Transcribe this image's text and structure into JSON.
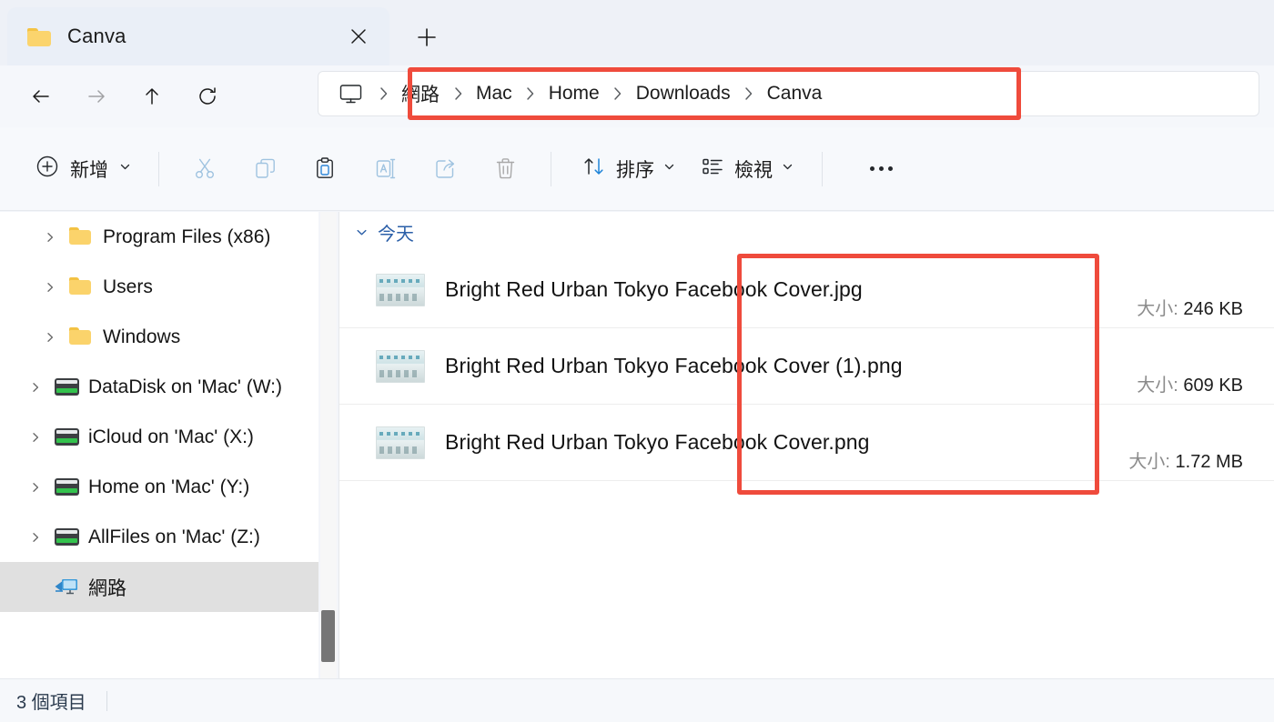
{
  "window": {
    "tab": {
      "title": "Canva",
      "icon": "folder-icon",
      "close_icon": "close-icon"
    },
    "new_tab_icon": "plus-icon"
  },
  "nav": {
    "back_icon": "arrow-left-icon",
    "forward_icon": "arrow-right-icon",
    "up_icon": "arrow-up-icon",
    "refresh_icon": "refresh-icon"
  },
  "address": {
    "root_icon": "monitor-icon",
    "separator": "chevron-right-icon",
    "crumbs": [
      {
        "label": "網路"
      },
      {
        "label": "Mac"
      },
      {
        "label": "Home"
      },
      {
        "label": "Downloads"
      },
      {
        "label": "Canva"
      }
    ]
  },
  "toolbar": {
    "new_label": "新增",
    "new_icon": "plus-circle-icon",
    "new_chevron": "chevron-down-icon",
    "actions": [
      {
        "name": "cut-button",
        "icon": "scissors-icon",
        "disabled": true
      },
      {
        "name": "copy-button",
        "icon": "copy-icon",
        "disabled": true
      },
      {
        "name": "paste-button",
        "icon": "paste-icon",
        "disabled": false
      },
      {
        "name": "rename-button",
        "icon": "rename-icon",
        "disabled": true
      },
      {
        "name": "share-button",
        "icon": "share-icon",
        "disabled": true
      },
      {
        "name": "delete-button",
        "icon": "trash-icon",
        "disabled": true
      }
    ],
    "sort_label": "排序",
    "sort_icon": "sort-icon",
    "view_label": "檢視",
    "view_icon": "view-list-icon",
    "overflow_icon": "more-horizontal-icon"
  },
  "sidebar": {
    "items": [
      {
        "label": "Program Files (x86)",
        "icon": "folder-icon",
        "indent": 2,
        "expandable": true,
        "selected": false
      },
      {
        "label": "Users",
        "icon": "folder-icon",
        "indent": 2,
        "expandable": true,
        "selected": false
      },
      {
        "label": "Windows",
        "icon": "folder-icon",
        "indent": 2,
        "expandable": true,
        "selected": false
      },
      {
        "label": "DataDisk on 'Mac' (W:)",
        "icon": "drive-icon",
        "indent": 1,
        "expandable": true,
        "selected": false
      },
      {
        "label": "iCloud on 'Mac' (X:)",
        "icon": "drive-icon",
        "indent": 1,
        "expandable": true,
        "selected": false
      },
      {
        "label": "Home on 'Mac' (Y:)",
        "icon": "drive-icon",
        "indent": 1,
        "expandable": true,
        "selected": false
      },
      {
        "label": "AllFiles on 'Mac' (Z:)",
        "icon": "drive-icon",
        "indent": 1,
        "expandable": true,
        "selected": false
      },
      {
        "label": "網路",
        "icon": "network-icon",
        "indent": 1,
        "expandable": false,
        "selected": true
      }
    ]
  },
  "filelist": {
    "group_label": "今天",
    "group_chevron": "chevron-down-icon",
    "size_label": "大小:",
    "files": [
      {
        "name": "Bright Red Urban Tokyo Facebook Cover.jpg",
        "size": "246 KB",
        "icon": "image-thumbnail"
      },
      {
        "name": "Bright Red Urban Tokyo Facebook Cover (1).png",
        "size": "609 KB",
        "icon": "image-thumbnail"
      },
      {
        "name": "Bright Red Urban Tokyo Facebook Cover.png",
        "size": "1.72 MB",
        "icon": "image-thumbnail"
      }
    ]
  },
  "statusbar": {
    "item_count": "3 個項目"
  },
  "annotations": {
    "color": "#ef4b3c",
    "boxes": [
      {
        "name": "breadcrumb-highlight"
      },
      {
        "name": "file-sizes-highlight"
      }
    ]
  }
}
